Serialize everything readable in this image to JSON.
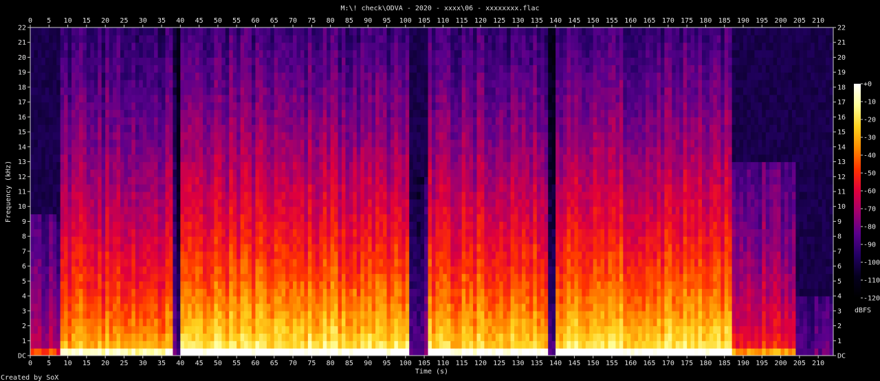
{
  "chart_data": {
    "type": "heatmap",
    "title": "M:\\! check\\ODVA - 2020 - xxxx\\06 - xxxxxxxx.flac",
    "xlabel": "Time (s)",
    "ylabel": "Frequency (kHz)",
    "xlim": [
      0,
      214
    ],
    "ylim": [
      0,
      22
    ],
    "x_ticks": [
      0,
      5,
      10,
      15,
      20,
      25,
      30,
      35,
      40,
      45,
      50,
      55,
      60,
      65,
      70,
      75,
      80,
      85,
      90,
      95,
      100,
      105,
      110,
      115,
      120,
      125,
      130,
      135,
      140,
      145,
      150,
      155,
      160,
      165,
      170,
      175,
      180,
      185,
      190,
      195,
      200,
      205,
      210
    ],
    "y_ticks": [
      "DC",
      "1",
      "2",
      "3",
      "4",
      "5",
      "6",
      "7",
      "8",
      "9",
      "10",
      "11",
      "12",
      "13",
      "14",
      "15",
      "16",
      "17",
      "18",
      "19",
      "20",
      "21",
      "22"
    ],
    "colorbar": {
      "unit": "dBFS",
      "range": [
        -120,
        0
      ],
      "ticks": [
        "+0",
        "-10",
        "-20",
        "-30",
        "-40",
        "-50",
        "-60",
        "-70",
        "-80",
        "-90",
        "-100",
        "-110",
        "-120"
      ],
      "colors": [
        "#ffffff",
        "#ffff9a",
        "#ffd21e",
        "#ff8c00",
        "#ff3200",
        "#e0003c",
        "#a0006e",
        "#5a008c",
        "#230064",
        "#05001e",
        "#000000"
      ]
    },
    "energy_profile": [
      {
        "t_start": 0,
        "t_end": 8,
        "level": 0.45,
        "top_khz": 9.5
      },
      {
        "t_start": 8,
        "t_end": 38,
        "level": 0.8,
        "top_khz": 22
      },
      {
        "t_start": 38,
        "t_end": 40,
        "level": 0.3,
        "top_khz": 22
      },
      {
        "t_start": 40,
        "t_end": 101,
        "level": 0.9,
        "top_khz": 22
      },
      {
        "t_start": 101,
        "t_end": 106,
        "level": 0.35,
        "top_khz": 12
      },
      {
        "t_start": 106,
        "t_end": 138,
        "level": 0.87,
        "top_khz": 22
      },
      {
        "t_start": 138,
        "t_end": 140,
        "level": 0.3,
        "top_khz": 22
      },
      {
        "t_start": 140,
        "t_end": 187,
        "level": 0.9,
        "top_khz": 22
      },
      {
        "t_start": 187,
        "t_end": 204,
        "level": 0.6,
        "top_khz": 13
      },
      {
        "t_start": 204,
        "t_end": 214,
        "level": 0.3,
        "top_khz": 4
      }
    ],
    "grid": false
  },
  "footer": {
    "credit": "Created by SoX"
  }
}
